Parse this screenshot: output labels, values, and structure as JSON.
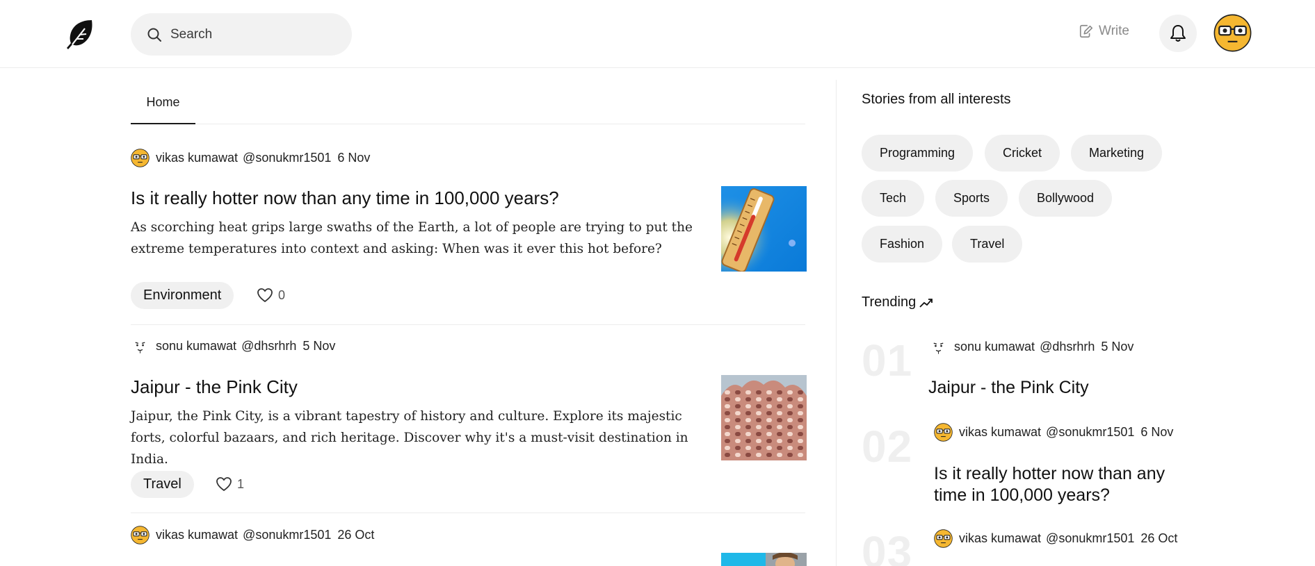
{
  "header": {
    "search_placeholder": "Search",
    "write_label": "Write"
  },
  "tabs": [
    {
      "label": "Home"
    }
  ],
  "feed": [
    {
      "author": "vikas kumawat",
      "handle": "@sonukmr1501",
      "date": "6 Nov",
      "avatar": "yellow-glasses-avatar",
      "title": "Is it really hotter now than any time in 100,000 years?",
      "excerpt": "As scorching heat grips large swaths of the Earth, a lot of people are trying to put the extreme temperatures into context and asking: When was it ever this hot before?",
      "tag": "Environment",
      "likes": "0",
      "image": "thermometer-sky-image"
    },
    {
      "author": "sonu kumawat",
      "handle": "@dhsrhrh",
      "date": "5 Nov",
      "avatar": "sketch-face-avatar",
      "title": "Jaipur - the Pink City",
      "excerpt": "Jaipur, the Pink City, is a vibrant tapestry of history and culture. Explore its majestic forts, colorful bazaars, and rich heritage. Discover why it's a must-visit destination in India.",
      "tag": "Travel",
      "likes": "1",
      "image": "hawa-mahal-image"
    },
    {
      "author": "vikas kumawat",
      "handle": "@sonukmr1501",
      "date": "26 Oct",
      "avatar": "yellow-glasses-avatar",
      "image": "portrait-image"
    }
  ],
  "sidebar": {
    "title": "Stories from all interests",
    "interests": [
      "Programming",
      "Cricket",
      "Marketing",
      "Tech",
      "Sports",
      "Bollywood",
      "Fashion",
      "Travel"
    ],
    "trending_title": "Trending",
    "trending": [
      {
        "num": "01",
        "author": "sonu kumawat",
        "handle": "@dhsrhrh",
        "date": "5 Nov",
        "title": "Jaipur - the Pink City"
      },
      {
        "num": "02",
        "author": "vikas kumawat",
        "handle": "@sonukmr1501",
        "date": "6 Nov",
        "title": "Is it really hotter now than any time in 100,000 years?"
      },
      {
        "num": "03",
        "author": "vikas kumawat",
        "handle": "@sonukmr1501",
        "date": "26 Oct",
        "title": ""
      }
    ]
  },
  "colors": {
    "avatar_yellow": "#f5b731",
    "pill_bg": "#f0f0f0",
    "border": "#ececec"
  }
}
